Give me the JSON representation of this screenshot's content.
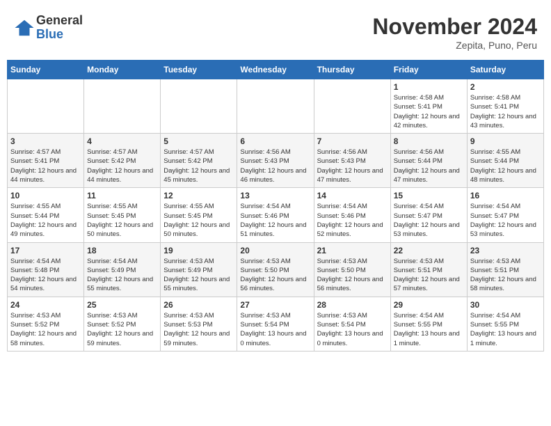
{
  "header": {
    "logo_general": "General",
    "logo_blue": "Blue",
    "month_year": "November 2024",
    "location": "Zepita, Puno, Peru"
  },
  "days_of_week": [
    "Sunday",
    "Monday",
    "Tuesday",
    "Wednesday",
    "Thursday",
    "Friday",
    "Saturday"
  ],
  "weeks": [
    [
      {
        "day": "",
        "info": ""
      },
      {
        "day": "",
        "info": ""
      },
      {
        "day": "",
        "info": ""
      },
      {
        "day": "",
        "info": ""
      },
      {
        "day": "",
        "info": ""
      },
      {
        "day": "1",
        "info": "Sunrise: 4:58 AM\nSunset: 5:41 PM\nDaylight: 12 hours and 42 minutes."
      },
      {
        "day": "2",
        "info": "Sunrise: 4:58 AM\nSunset: 5:41 PM\nDaylight: 12 hours and 43 minutes."
      }
    ],
    [
      {
        "day": "3",
        "info": "Sunrise: 4:57 AM\nSunset: 5:41 PM\nDaylight: 12 hours and 44 minutes."
      },
      {
        "day": "4",
        "info": "Sunrise: 4:57 AM\nSunset: 5:42 PM\nDaylight: 12 hours and 44 minutes."
      },
      {
        "day": "5",
        "info": "Sunrise: 4:57 AM\nSunset: 5:42 PM\nDaylight: 12 hours and 45 minutes."
      },
      {
        "day": "6",
        "info": "Sunrise: 4:56 AM\nSunset: 5:43 PM\nDaylight: 12 hours and 46 minutes."
      },
      {
        "day": "7",
        "info": "Sunrise: 4:56 AM\nSunset: 5:43 PM\nDaylight: 12 hours and 47 minutes."
      },
      {
        "day": "8",
        "info": "Sunrise: 4:56 AM\nSunset: 5:44 PM\nDaylight: 12 hours and 47 minutes."
      },
      {
        "day": "9",
        "info": "Sunrise: 4:55 AM\nSunset: 5:44 PM\nDaylight: 12 hours and 48 minutes."
      }
    ],
    [
      {
        "day": "10",
        "info": "Sunrise: 4:55 AM\nSunset: 5:44 PM\nDaylight: 12 hours and 49 minutes."
      },
      {
        "day": "11",
        "info": "Sunrise: 4:55 AM\nSunset: 5:45 PM\nDaylight: 12 hours and 50 minutes."
      },
      {
        "day": "12",
        "info": "Sunrise: 4:55 AM\nSunset: 5:45 PM\nDaylight: 12 hours and 50 minutes."
      },
      {
        "day": "13",
        "info": "Sunrise: 4:54 AM\nSunset: 5:46 PM\nDaylight: 12 hours and 51 minutes."
      },
      {
        "day": "14",
        "info": "Sunrise: 4:54 AM\nSunset: 5:46 PM\nDaylight: 12 hours and 52 minutes."
      },
      {
        "day": "15",
        "info": "Sunrise: 4:54 AM\nSunset: 5:47 PM\nDaylight: 12 hours and 53 minutes."
      },
      {
        "day": "16",
        "info": "Sunrise: 4:54 AM\nSunset: 5:47 PM\nDaylight: 12 hours and 53 minutes."
      }
    ],
    [
      {
        "day": "17",
        "info": "Sunrise: 4:54 AM\nSunset: 5:48 PM\nDaylight: 12 hours and 54 minutes."
      },
      {
        "day": "18",
        "info": "Sunrise: 4:54 AM\nSunset: 5:49 PM\nDaylight: 12 hours and 55 minutes."
      },
      {
        "day": "19",
        "info": "Sunrise: 4:53 AM\nSunset: 5:49 PM\nDaylight: 12 hours and 55 minutes."
      },
      {
        "day": "20",
        "info": "Sunrise: 4:53 AM\nSunset: 5:50 PM\nDaylight: 12 hours and 56 minutes."
      },
      {
        "day": "21",
        "info": "Sunrise: 4:53 AM\nSunset: 5:50 PM\nDaylight: 12 hours and 56 minutes."
      },
      {
        "day": "22",
        "info": "Sunrise: 4:53 AM\nSunset: 5:51 PM\nDaylight: 12 hours and 57 minutes."
      },
      {
        "day": "23",
        "info": "Sunrise: 4:53 AM\nSunset: 5:51 PM\nDaylight: 12 hours and 58 minutes."
      }
    ],
    [
      {
        "day": "24",
        "info": "Sunrise: 4:53 AM\nSunset: 5:52 PM\nDaylight: 12 hours and 58 minutes."
      },
      {
        "day": "25",
        "info": "Sunrise: 4:53 AM\nSunset: 5:52 PM\nDaylight: 12 hours and 59 minutes."
      },
      {
        "day": "26",
        "info": "Sunrise: 4:53 AM\nSunset: 5:53 PM\nDaylight: 12 hours and 59 minutes."
      },
      {
        "day": "27",
        "info": "Sunrise: 4:53 AM\nSunset: 5:54 PM\nDaylight: 13 hours and 0 minutes."
      },
      {
        "day": "28",
        "info": "Sunrise: 4:53 AM\nSunset: 5:54 PM\nDaylight: 13 hours and 0 minutes."
      },
      {
        "day": "29",
        "info": "Sunrise: 4:54 AM\nSunset: 5:55 PM\nDaylight: 13 hours and 1 minute."
      },
      {
        "day": "30",
        "info": "Sunrise: 4:54 AM\nSunset: 5:55 PM\nDaylight: 13 hours and 1 minute."
      }
    ]
  ]
}
